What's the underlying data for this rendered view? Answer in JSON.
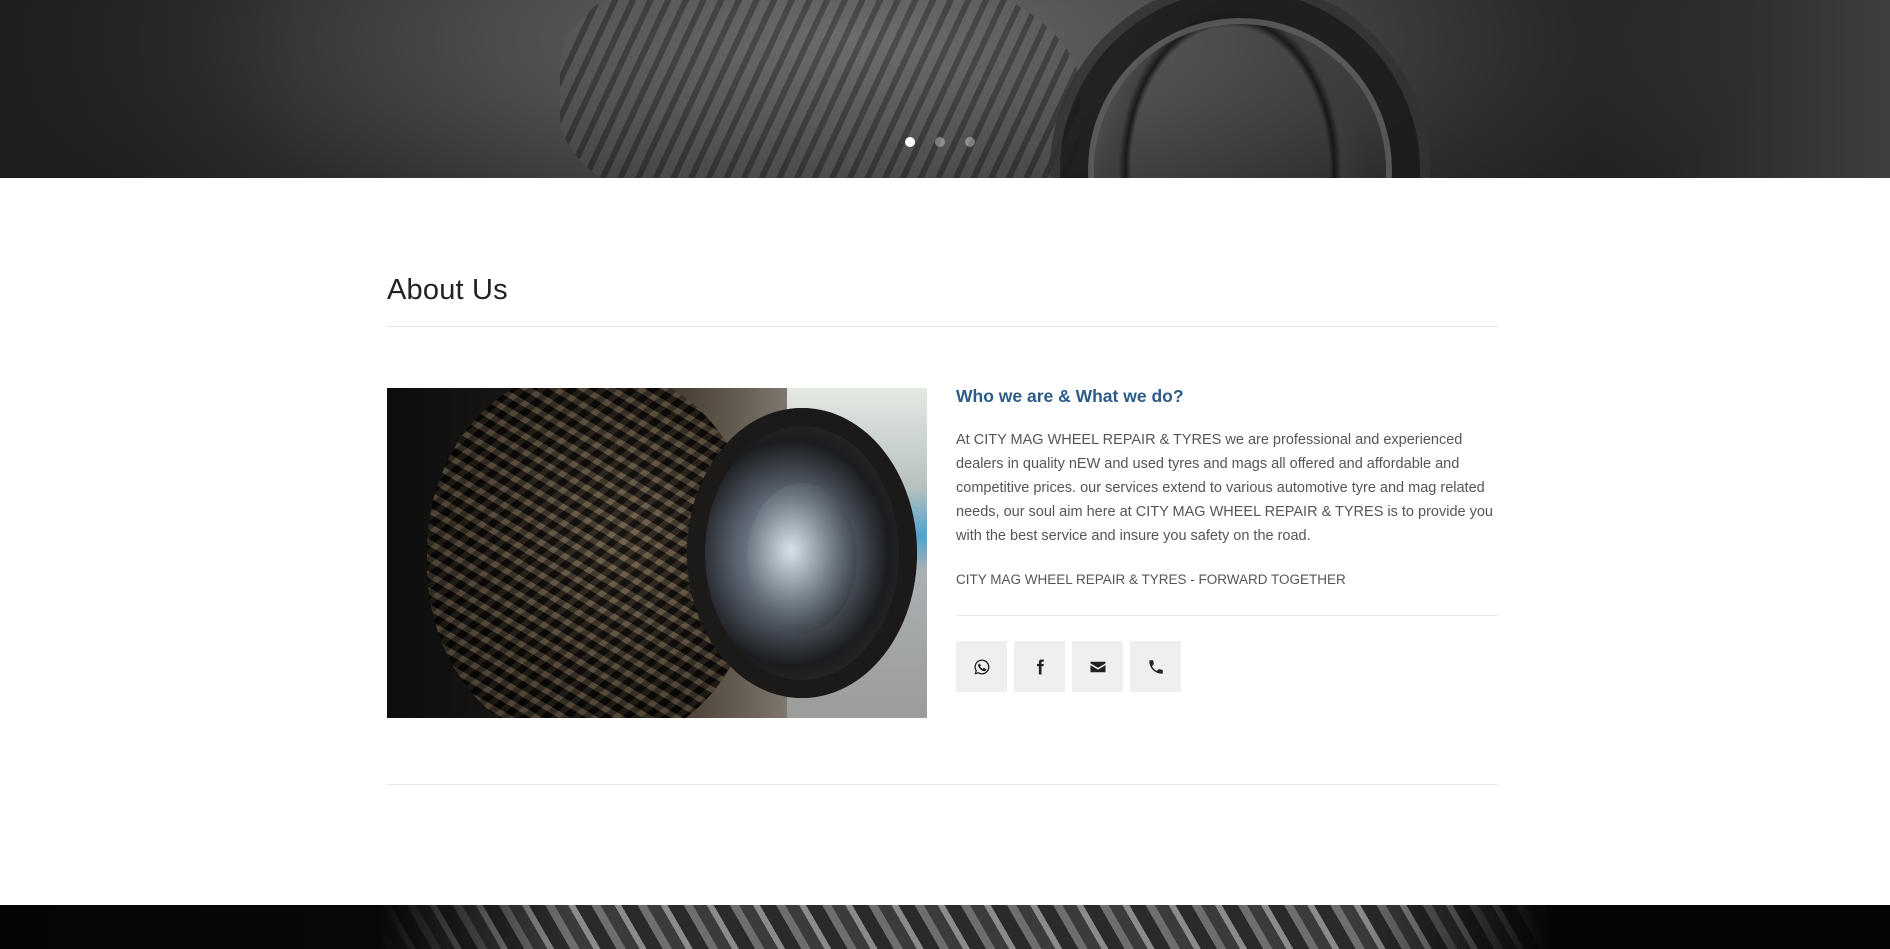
{
  "hero": {
    "slides": [
      {
        "active": true
      },
      {
        "active": false
      },
      {
        "active": false
      }
    ]
  },
  "about": {
    "title": "About Us",
    "heading": "Who we are & What we do?",
    "body": "At CITY MAG WHEEL REPAIR & TYRES we are professional and experienced dealers in quality nEW and used tyres and mags all offered and affordable and competitive prices. our services extend to various automotive tyre and mag related needs, our soul aim here at CITY MAG WHEEL REPAIR & TYRES is to provide you with the best service and insure you safety on the road.",
    "tagline": "CITY MAG WHEEL REPAIR & TYRES - FORWARD TOGETHER",
    "socials": [
      {
        "icon": "whatsapp-icon"
      },
      {
        "icon": "facebook-icon"
      },
      {
        "icon": "email-icon"
      },
      {
        "icon": "phone-icon"
      }
    ]
  },
  "colors": {
    "heading_accent": "#2b5b86",
    "social_bg": "#efefef"
  }
}
